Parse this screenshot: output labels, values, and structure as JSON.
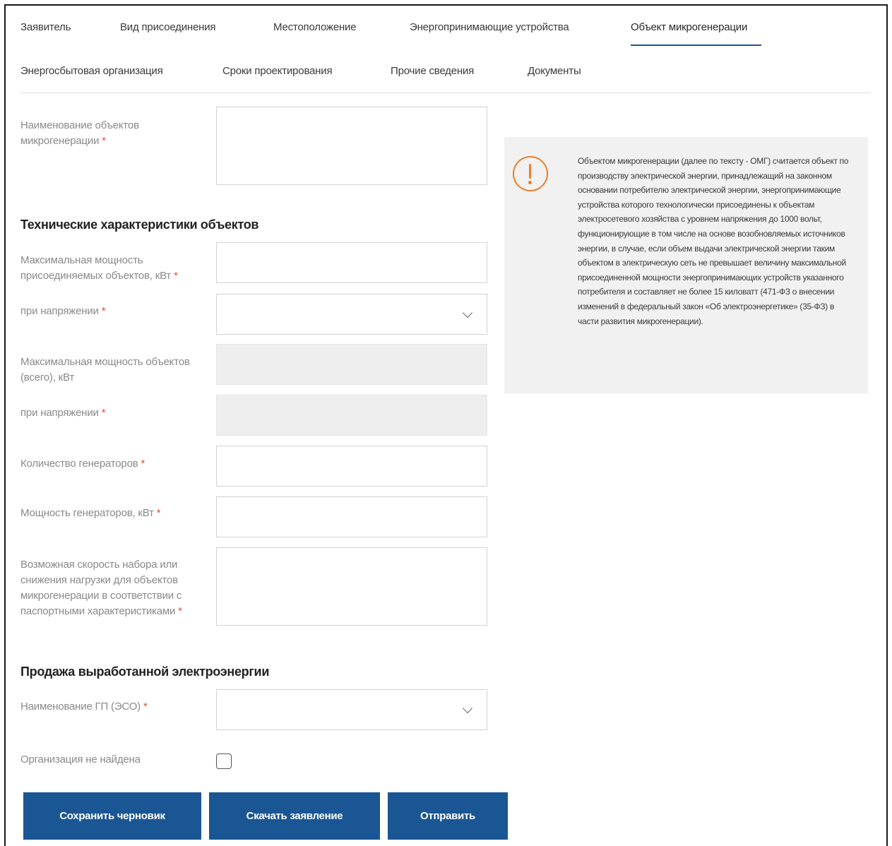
{
  "tabs": {
    "row1": [
      "Заявитель",
      "Вид присоединения",
      "Местоположение",
      "Энергопринимающие устройства",
      "Объект микрогенерации"
    ],
    "row2": [
      "Энергосбытовая организация",
      "Сроки проектирования",
      "Прочие сведения",
      "Документы"
    ],
    "active": "Объект микрогенерации"
  },
  "form": {
    "name_label": "Наименование объектов микрогенерации",
    "section_tech": "Технические характеристики объектов",
    "max_power_label": "Максимальная мощность присоединяемых объектов, кВт",
    "voltage_label": "при напряжении",
    "max_power_total_label": "Максимальная мощность объектов (всего), кВт",
    "voltage2_label": "при напряжении",
    "generators_count_label": "Количество генераторов",
    "generators_power_label": "Мощность генераторов, кВт",
    "load_rate_label": "Возможная скорость набора или снижения нагрузки для объектов микрогенерации в соответствии с паспортными характеристиками",
    "section_sale": "Продажа выработанной электроэнергии",
    "gp_name_label": "Наименование ГП (ЭСО)",
    "org_not_found_label": "Организация не найдена",
    "required_mark": "*"
  },
  "info": {
    "text": "Объектом микрогенерации (далее по тексту - ОМГ) считается объект по производству электрической энергии, принадлежащий на законном основании потребителю электрической энергии, энергопринимающие устройства которого технологически присоединены к объектам электросетевого хозяйства с уровнем напряжения до 1000 вольт, функционирующие в том числе на основе возобновляемых источников энергии, в случае, если объем выдачи электрической энергии таким объектом в электрическую сеть не превышает величину максимальной присоединенной мощности энергопринимающих устройств указанного потребителя и составляет не более 15 киловатт (471-ФЗ о внесении изменений в федеральный закон «Об электроэнергетике» (35-ФЗ) в части развития микрогенерации)."
  },
  "buttons": {
    "save_draft": "Сохранить черновик",
    "download": "Скачать заявление",
    "send": "Отправить"
  },
  "colors": {
    "accent": "#1a5693",
    "warning": "#ef7d2c",
    "required": "#e44a3a"
  }
}
